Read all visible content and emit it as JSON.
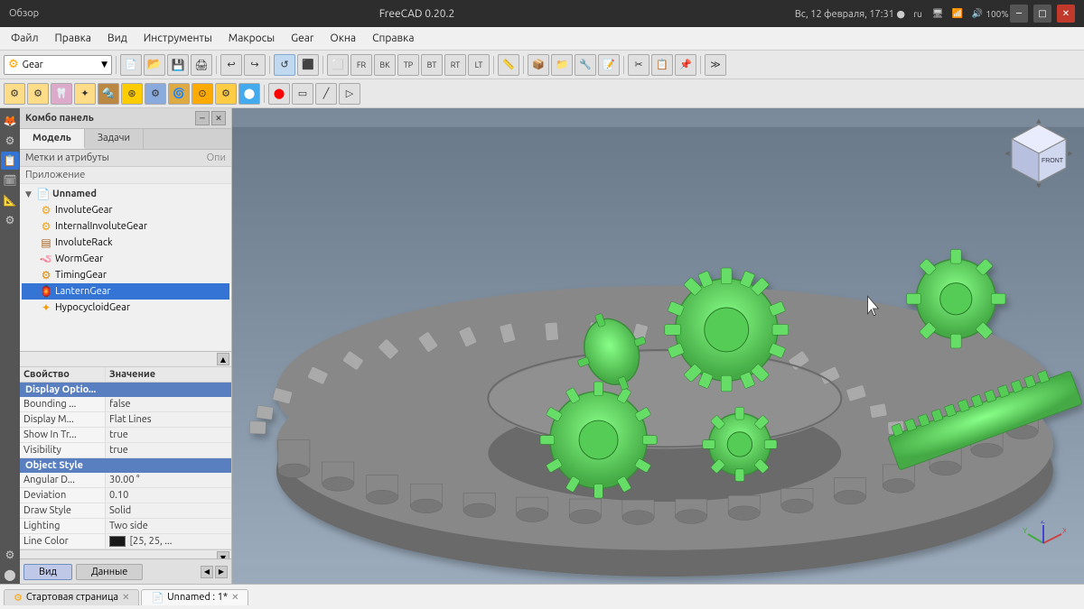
{
  "window": {
    "title": "FreeCAD 0.20.2",
    "taskbar_left": "Обзор",
    "datetime": "Вс, 12 февраля, 17:31 ●",
    "locale": "ru",
    "battery": "100%"
  },
  "menubar": {
    "items": [
      "Файл",
      "Правка",
      "Вид",
      "Инструменты",
      "Макросы",
      "Gear",
      "Окна",
      "Справка"
    ]
  },
  "toolbar1": {
    "workbench_label": "Gear",
    "buttons": [
      "⬤",
      "↩",
      "↪",
      "⬛",
      "⬜",
      "🏠",
      "▶",
      "◼",
      "🔍",
      "✦"
    ]
  },
  "combo_panel": {
    "title": "Комбо панель",
    "tabs": [
      "Модель",
      "Задачи"
    ],
    "active_tab": "Модель",
    "attributes_header": "Метки и атрибуты",
    "attributes_col": "Опи",
    "app_label": "Приложение",
    "tree": {
      "root": {
        "label": "Unnamed",
        "icon": "document-icon",
        "expanded": true,
        "children": [
          {
            "label": "InvoluteGear",
            "icon": "gear-icon",
            "selected": false
          },
          {
            "label": "InternalInvoluteGear",
            "icon": "gear-icon",
            "selected": false
          },
          {
            "label": "InvoluteRack",
            "icon": "rack-icon",
            "selected": false
          },
          {
            "label": "WormGear",
            "icon": "worm-icon",
            "selected": false
          },
          {
            "label": "TimingGear",
            "icon": "timing-icon",
            "selected": false
          },
          {
            "label": "LanternGear",
            "icon": "lantern-icon",
            "selected": true
          },
          {
            "label": "HypocycloidGear",
            "icon": "hypo-icon",
            "selected": false
          }
        ]
      }
    }
  },
  "properties": {
    "header_prop": "Свойство",
    "header_val": "Значение",
    "sections": [
      {
        "name": "Display Optio...",
        "rows": [
          {
            "name": "Bounding ...",
            "value": "false"
          },
          {
            "name": "Display M...",
            "value": "Flat Lines"
          },
          {
            "name": "Show In Tr...",
            "value": "true"
          },
          {
            "name": "Visibility",
            "value": "true"
          }
        ]
      },
      {
        "name": "Object Style",
        "rows": [
          {
            "name": "Angular D...",
            "value": "30.00 °"
          },
          {
            "name": "Deviation",
            "value": "0.10"
          },
          {
            "name": "Draw Style",
            "value": "Solid"
          },
          {
            "name": "Lighting",
            "value": "Two side"
          },
          {
            "name": "Line Color",
            "value": "[25, 25, ..."
          }
        ]
      }
    ]
  },
  "sidebar_bottom": {
    "btn1": "Вид",
    "btn2": "Данные"
  },
  "bottom_tabs": [
    {
      "label": "Стартовая страница",
      "closeable": true,
      "active": false,
      "icon": "freecad-icon"
    },
    {
      "label": "Unnamed : 1*",
      "closeable": true,
      "active": true,
      "icon": "document-icon"
    }
  ],
  "viewport": {
    "background_top": "#6a7a8a",
    "background_bottom": "#9aaabb",
    "navcube_face": "FRONT"
  },
  "icons": {
    "gear": "⚙",
    "document": "📄",
    "rack": "▤",
    "arrow_down": "▼",
    "arrow_right": "▶",
    "close": "✕",
    "minimize": "─",
    "maximize": "□"
  }
}
